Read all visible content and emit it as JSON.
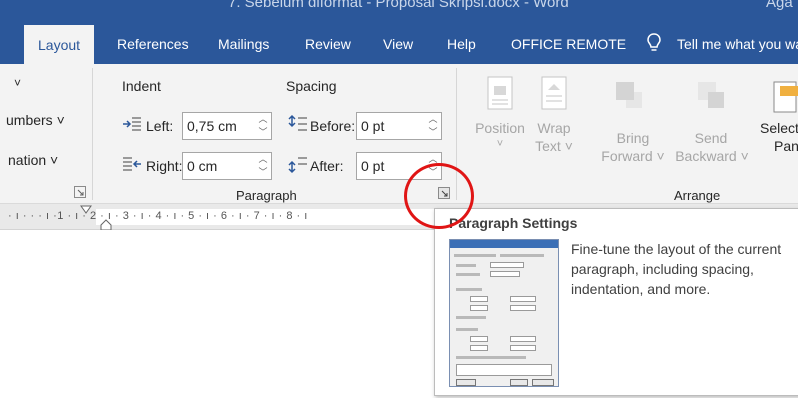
{
  "window": {
    "title": "7. Sebelum diformat - Proposal Skripsi.docx  -  Word",
    "user": "Aga"
  },
  "tabs": [
    {
      "label": "Layout",
      "active": true
    },
    {
      "label": "References"
    },
    {
      "label": "Mailings"
    },
    {
      "label": "Review"
    },
    {
      "label": "View"
    },
    {
      "label": "Help"
    },
    {
      "label": "OFFICE REMOTE"
    }
  ],
  "tell_me": {
    "placeholder": "Tell me what you wa",
    "icon": "lightbulb-icon"
  },
  "ribbon": {
    "page_setup_partial": {
      "dropdown_arrow": "˅",
      "line_numbers": "umbers ˅",
      "hyphenation": "nation ˅"
    },
    "paragraph": {
      "group_label": "Paragraph",
      "indent_header": "Indent",
      "spacing_header": "Spacing",
      "left_label": "Left:",
      "left_value": "0,75 cm",
      "right_label": "Right:",
      "right_value": "0 cm",
      "before_label": "Before:",
      "before_value": "0 pt",
      "after_label": "After:",
      "after_value": "0 pt"
    },
    "arrange": {
      "group_label": "Arrange",
      "position": "Position",
      "position_arrow": "˅",
      "wrap_line1": "Wrap",
      "wrap_line2": "Text ˅",
      "bring_line1": "Bring",
      "bring_line2": "Forward ˅",
      "send_line1": "Send",
      "send_line2": "Backward ˅",
      "selection_line1": "Selecti",
      "selection_line2": "Pane"
    }
  },
  "ruler": {
    "ticks": "· ı · ·  · ı ·1 · ı · 2 · ı · 3 · ı · 4 · ı · 5 · ı · 6 · ı · 7 · ı · 8 · ı"
  },
  "tooltip": {
    "title": "Paragraph Settings",
    "description": "Fine-tune the layout of the current paragraph, including spacing, indentation, and more."
  },
  "colors": {
    "ribbon_blue": "#2b579a",
    "ribbon_bg": "#f3f3f3",
    "highlight_circle": "#e01515"
  }
}
